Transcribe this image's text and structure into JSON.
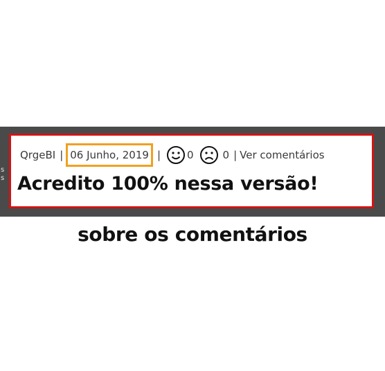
{
  "comment": {
    "author": "QrgeBI",
    "separator": "|",
    "date": "06 Junho, 2019",
    "like_icon": "smiley-face-icon",
    "likes": "0",
    "dislike_icon": "frowning-face-icon",
    "dislikes": "0",
    "view_comments_link": "Ver comentários",
    "text": "Acredito 100% nessa versão!"
  },
  "caption": "sobre os comentários",
  "colors": {
    "frame_border": "#d11414",
    "date_highlight": "#f0a020",
    "background_strip": "#4a4a4a"
  }
}
